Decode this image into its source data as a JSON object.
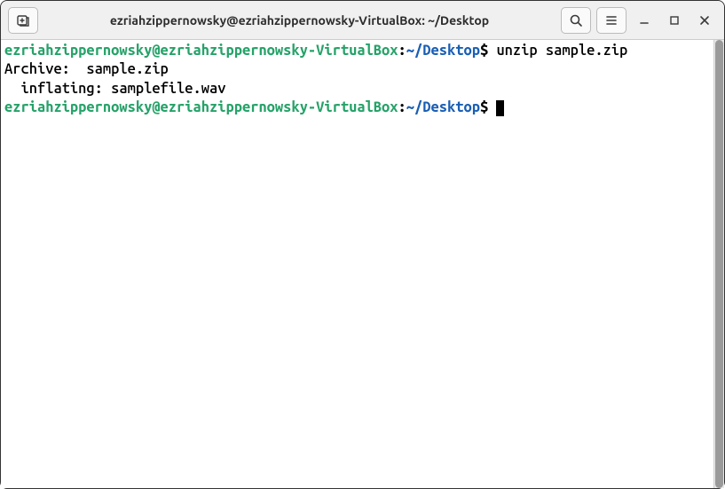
{
  "window": {
    "title": "ezriahzippernowsky@ezriahzippernowsky-VirtualBox: ~/Desktop"
  },
  "colors": {
    "user_host": "#26a269",
    "path": "#1a5fb4"
  },
  "prompt": {
    "user_host": "ezriahzippernowsky@ezriahzippernowsky-VirtualBox",
    "sep": ":",
    "path": "~/Desktop",
    "symbol": "$"
  },
  "terminal": {
    "lines": [
      {
        "type": "prompt",
        "command": "unzip sample.zip"
      },
      {
        "type": "output",
        "text": "Archive:  sample.zip"
      },
      {
        "type": "output",
        "text": "  inflating: samplefile.wav"
      },
      {
        "type": "prompt",
        "command": "",
        "cursor": true
      }
    ]
  },
  "icons": {
    "new_tab": "new-tab-icon",
    "search": "search-icon",
    "menu": "hamburger-icon",
    "minimize": "minimize-icon",
    "maximize": "maximize-icon",
    "close": "close-icon"
  }
}
